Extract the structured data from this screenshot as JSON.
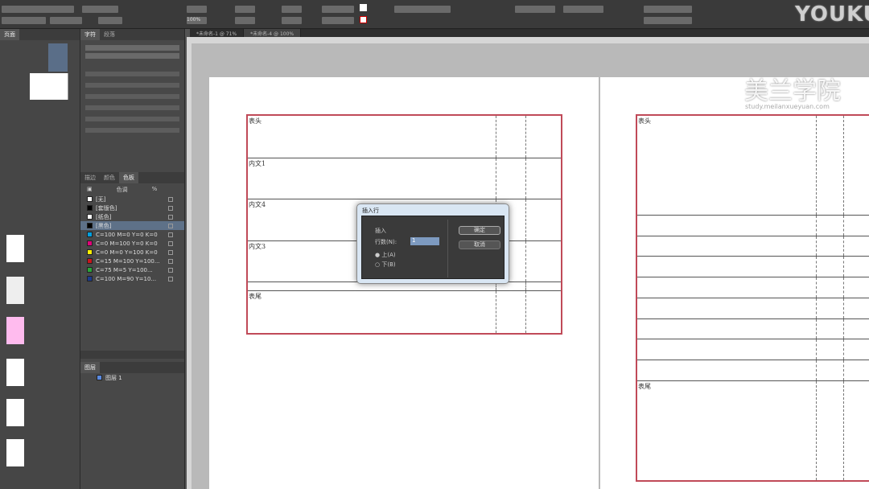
{
  "control_bar": {
    "zoom_field": "100%"
  },
  "document_tabs": [
    "*未命名-1 @ 71%",
    "*未命名-4 @ 100%"
  ],
  "swatches_panel": {
    "tabs": [
      "描边",
      "颜色",
      "色板"
    ],
    "active_tab": "色板",
    "tint_label": "色调",
    "tint_value": "%",
    "items": [
      {
        "name": "[无]",
        "color": "#ffffff"
      },
      {
        "name": "[套版色]",
        "color": "#000000"
      },
      {
        "name": "[纸色]",
        "color": "#ffffff"
      },
      {
        "name": "[黑色]",
        "color": "#000000",
        "selected": true
      },
      {
        "name": "C=100 M=0 Y=0 K=0",
        "color": "#00a0e0"
      },
      {
        "name": "C=0 M=100 Y=0 K=0",
        "color": "#e0007a"
      },
      {
        "name": "C=0 M=0 Y=100 K=0",
        "color": "#fff000"
      },
      {
        "name": "C=15 M=100 Y=100...",
        "color": "#c8161d"
      },
      {
        "name": "C=75 M=5 Y=100...",
        "color": "#2aa43a"
      },
      {
        "name": "C=100 M=90 Y=10...",
        "color": "#1c3b8c"
      }
    ]
  },
  "layers_panel": {
    "tab": "图层",
    "layer": "图层 1"
  },
  "table_left": {
    "rows": [
      "表头",
      "内文1",
      "内文4",
      "内文3",
      "",
      "表尾"
    ],
    "cols": 3
  },
  "table_right": {
    "first": "表头",
    "last": "表尾",
    "rows": 10,
    "cols": 3
  },
  "dialog": {
    "title": "插入行",
    "group_label": "插入",
    "rows_label": "行数(N):",
    "rows_value": "1",
    "above_label": "上(A)",
    "below_label": "下(B)",
    "ok_label": "确定",
    "cancel_label": "取消"
  },
  "watermark": {
    "brand": "YOUKU",
    "school": "美兰学院",
    "url": "study.meilanxueyuan.com"
  },
  "colors": {
    "table_border": "#c04a58",
    "selection": "#5e7188"
  }
}
